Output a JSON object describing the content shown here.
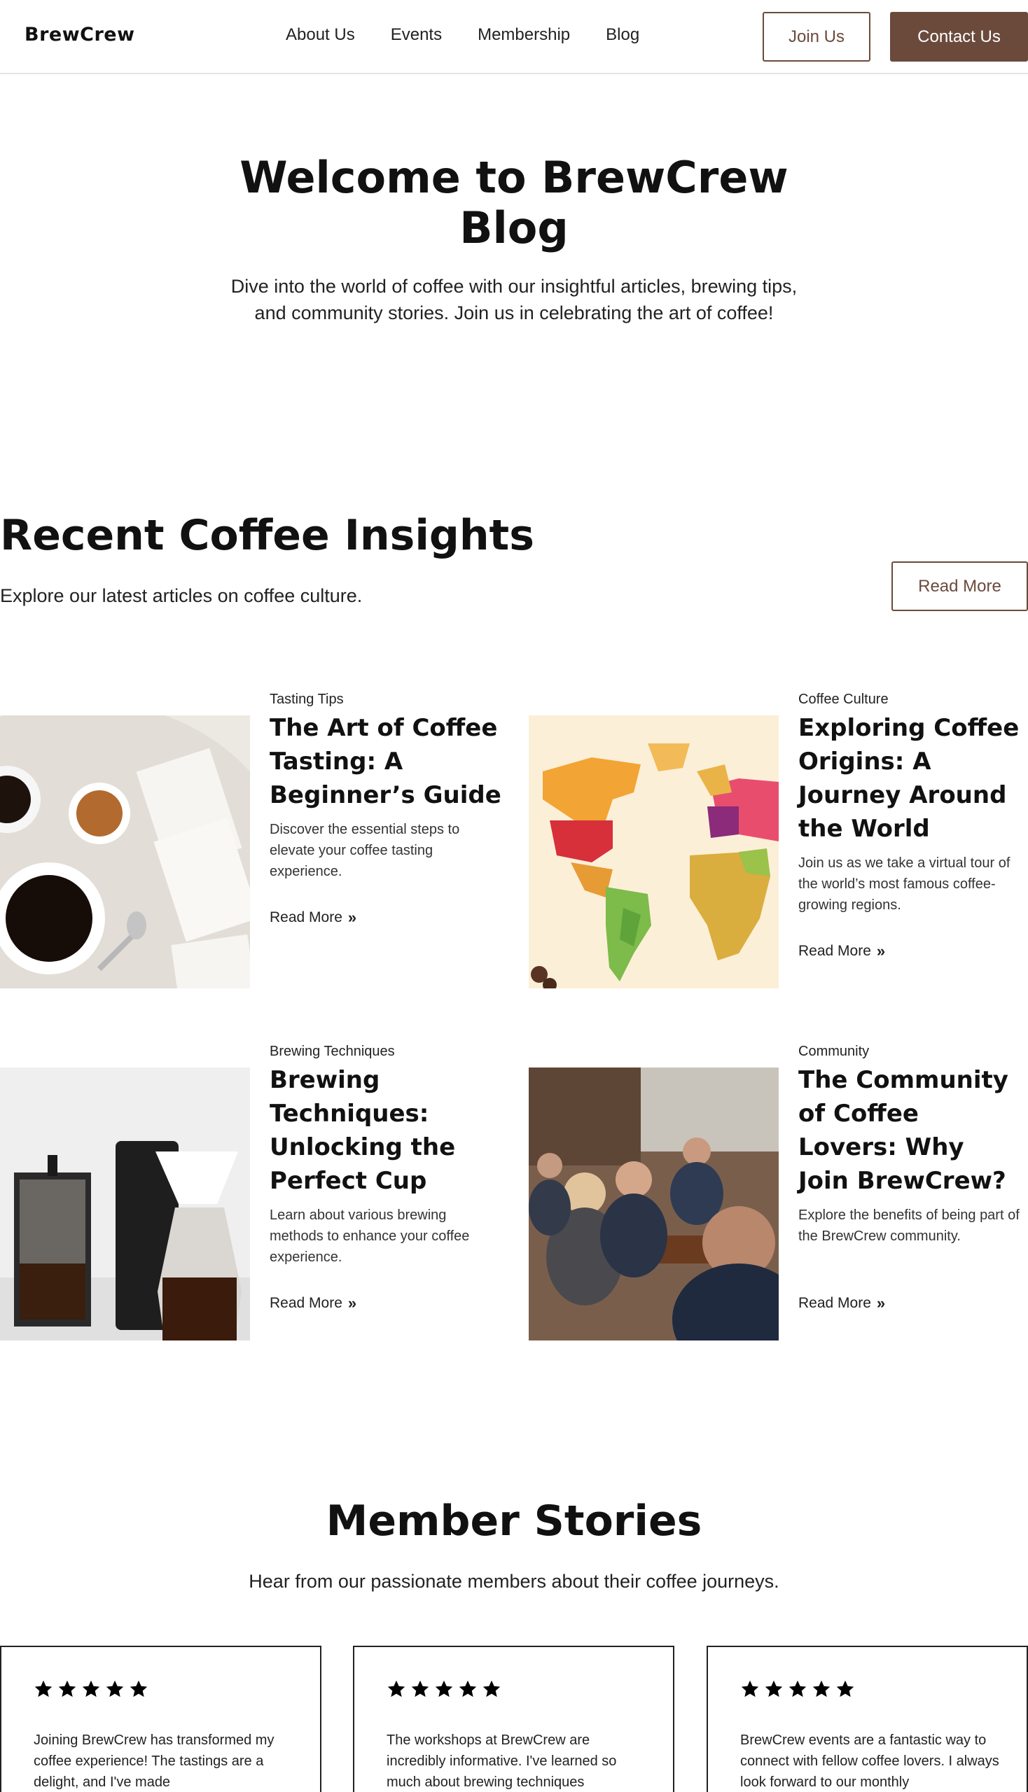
{
  "nav": {
    "logo": "BrewCrew",
    "links": [
      "About Us",
      "Events",
      "Membership",
      "Blog"
    ],
    "join_label": "Join Us",
    "contact_label": "Contact Us"
  },
  "hero": {
    "title": "Welcome to BrewCrew Blog",
    "subtitle": "Dive into the world of coffee with our insightful articles, brewing tips, and community stories. Join us in celebrating the art of coffee!"
  },
  "insights": {
    "title": "Recent Coffee Insights",
    "subtitle": "Explore our latest articles on coffee culture.",
    "read_more_label": "Read More",
    "cards": [
      {
        "category": "Tasting Tips",
        "title": "The Art of Coffee Tasting: A Beginner’s Guide",
        "description": "Discover the essential steps to elevate your coffee tasting experience.",
        "link": "Read More"
      },
      {
        "category": "Coffee Culture",
        "title": "Exploring Coffee Origins: A Journey Around the World",
        "description": "Join us as we take a virtual tour of the world’s most famous coffee-growing regions.",
        "link": "Read More"
      },
      {
        "category": "Brewing Techniques",
        "title": "Brewing Techniques: Unlocking the Perfect Cup",
        "description": "Learn about various brewing methods to enhance your coffee experience.",
        "link": "Read More"
      },
      {
        "category": "Community",
        "title": "The Community of Coffee Lovers: Why Join BrewCrew?",
        "description": "Explore the benefits of being part of the BrewCrew community.",
        "link": "Read More"
      }
    ]
  },
  "stories": {
    "title": "Member Stories",
    "subtitle": "Hear from our passionate members about their coffee journeys.",
    "items": [
      {
        "rating": 5,
        "text": "Joining BrewCrew has transformed my coffee experience! The tastings are a delight, and I've made"
      },
      {
        "rating": 5,
        "text": "The workshops at BrewCrew are incredibly informative. I've learned so much about brewing techniques"
      },
      {
        "rating": 5,
        "text": "BrewCrew events are a fantastic way to connect with fellow coffee lovers. I always look forward to our monthly"
      }
    ]
  },
  "colors": {
    "brand": "#6b4a3c",
    "text": "#111111"
  }
}
